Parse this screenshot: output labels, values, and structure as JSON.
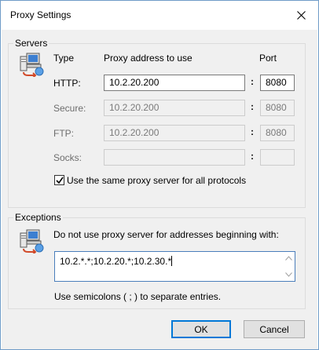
{
  "window": {
    "title": "Proxy Settings"
  },
  "servers": {
    "group_label": "Servers",
    "col_type": "Type",
    "col_address": "Proxy address to use",
    "col_port": "Port",
    "colon": ":",
    "rows": [
      {
        "label": "HTTP:",
        "address": "10.2.20.200",
        "port": "8080",
        "enabled": true
      },
      {
        "label": "Secure:",
        "address": "10.2.20.200",
        "port": "8080",
        "enabled": false
      },
      {
        "label": "FTP:",
        "address": "10.2.20.200",
        "port": "8080",
        "enabled": false
      },
      {
        "label": "Socks:",
        "address": "",
        "port": "",
        "enabled": false
      }
    ],
    "same_proxy": {
      "label": "Use the same proxy server for all protocols",
      "checked": true
    }
  },
  "exceptions": {
    "group_label": "Exceptions",
    "description": "Do not use proxy server for addresses beginning with:",
    "value": "10.2.*.*;10.2.20.*;10.2.30.*",
    "hint": "Use semicolons ( ; ) to separate entries."
  },
  "buttons": {
    "ok": "OK",
    "cancel": "Cancel"
  },
  "icons": {
    "servers": "network-computer-icon",
    "exceptions": "network-computer-icon",
    "close": "close-icon"
  }
}
